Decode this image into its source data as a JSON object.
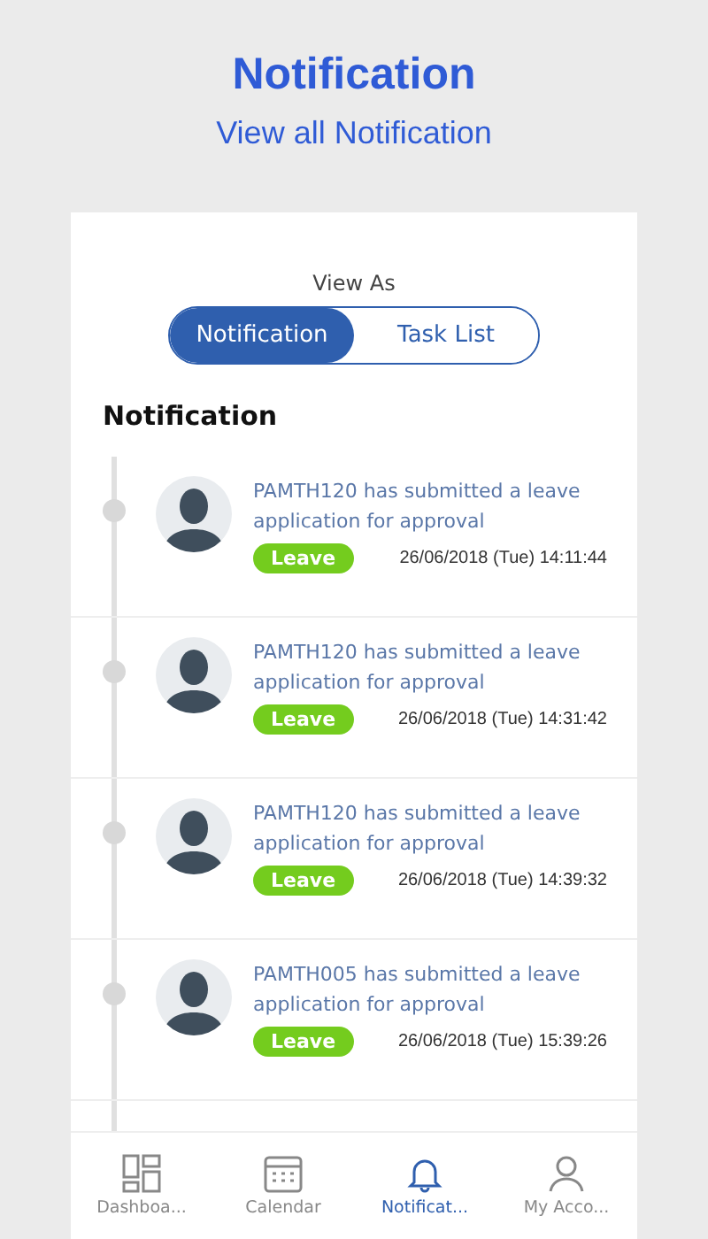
{
  "header": {
    "title": "Notification",
    "subtitle": "View all Notification"
  },
  "view_as": {
    "label": "View As",
    "options": [
      {
        "label": "Notification",
        "selected": true
      },
      {
        "label": "Task List",
        "selected": false
      }
    ]
  },
  "section_title": "Notification",
  "notifications": [
    {
      "message": "PAMTH120 has submitted a leave application for approval",
      "tag": "Leave",
      "time": "26/06/2018 (Tue) 14:11:44"
    },
    {
      "message": "PAMTH120 has submitted a leave application for approval",
      "tag": "Leave",
      "time": "26/06/2018 (Tue) 14:31:42"
    },
    {
      "message": "PAMTH120 has submitted a leave application for approval",
      "tag": "Leave",
      "time": "26/06/2018 (Tue) 14:39:32"
    },
    {
      "message": "PAMTH005 has submitted a leave application for approval",
      "tag": "Leave",
      "time": "26/06/2018 (Tue) 15:39:26"
    }
  ],
  "tab_bar": [
    {
      "label": "Dashboa...",
      "kind": "dashboard",
      "selected": false
    },
    {
      "label": "Calendar",
      "kind": "calendar",
      "selected": false
    },
    {
      "label": "Notificat...",
      "kind": "bell",
      "selected": true
    },
    {
      "label": "My Acco...",
      "kind": "account",
      "selected": false
    }
  ]
}
